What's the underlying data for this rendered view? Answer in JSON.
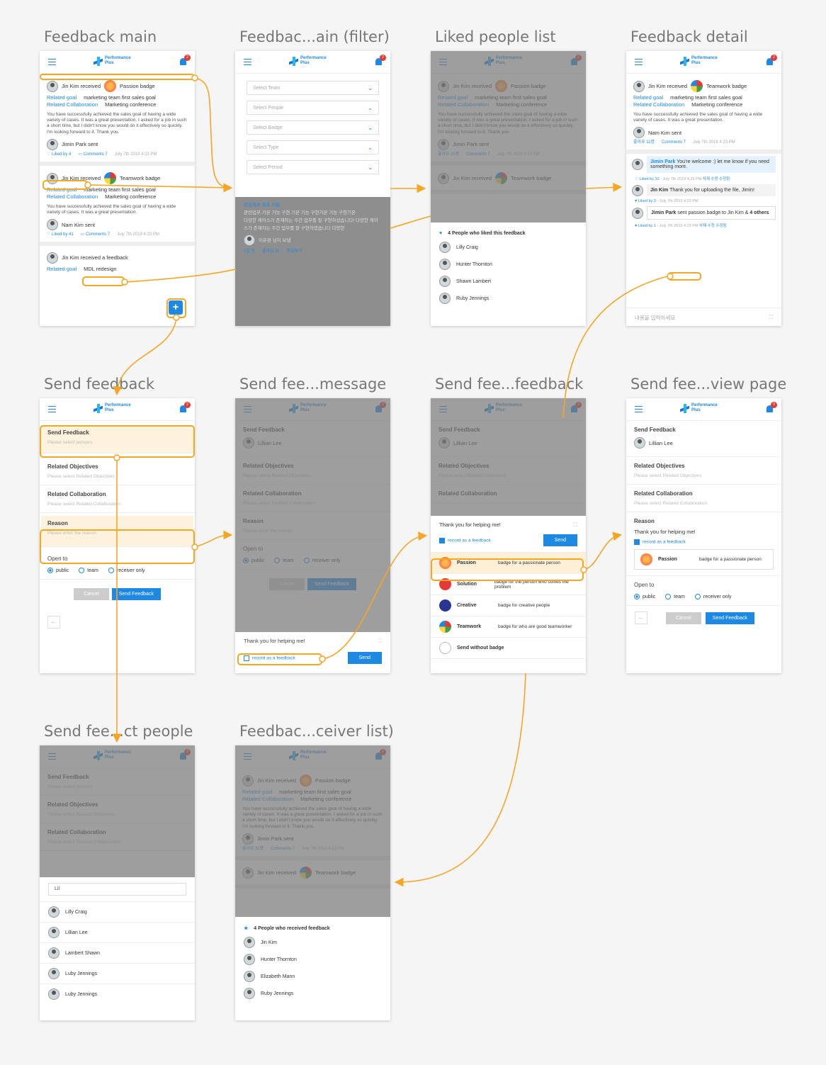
{
  "titles": [
    "Feedback main",
    "Feedbac...ain (filter)",
    "Liked people list",
    "Feedback detail",
    "Send feedback",
    "Send fee...message",
    "Send fee...feedback",
    "Send fee...view page",
    "Send fee...ct people",
    "Feedbac...ceiver list)"
  ],
  "logo": {
    "l1": "Performance",
    "l2": "Plus",
    "badge_count": "2"
  },
  "feed": {
    "jin": "Jin Kim received",
    "passion": "Passion badge",
    "teamwork": "Teamwork badge",
    "rg": "Related goal",
    "rg_val": "marketing team first sales goal",
    "rc": "Related Collaboration",
    "rc_val": "Marketing conference",
    "msg1": "You have successfully achieved the sales goal of having a wide variety of cases. It was a great presentation. I asked for a job in such a short time, but I didn't know you would do it effectively so quickly. I'm looking forward to it. Thank you.",
    "msg2": "You have successfully achieved the sales goal of having a wide variety of cases. It was a great presentation.",
    "jimin": "Jimin Park sent",
    "nam": "Nam Kim sent",
    "liked4": "Liked by 4",
    "liked41": "Liked by 41",
    "comments7": "Comments 7",
    "date": "July 7th 2019 4:23 PM",
    "jin_fb": "Jin Kim received a feedback",
    "rg_mdl": "MDL redesign",
    "ko_like": "좋아요 11명",
    "ko_comments": "Comments 7"
  },
  "filter": {
    "selects": [
      "Select Team",
      "Select People",
      "Select Badge",
      "Select Type",
      "Select Period"
    ],
    "ko1": "관련목표 목표 이름",
    "ko2": "관련업무 기본 기능 구현 기본 기능 구현기본 기능 구현기본",
    "ko3": "다양한 케이스가 존재하는 주간 업무를 잘 구현하셨습니다! 다양한 케이스가 존재하는 주간 업무를 잘 구현하였습니다 다양한",
    "ko4": "이은완 님이 보냄",
    "ko5": "1일 전",
    "ko6": "좋아요 11",
    "ko7": "댓글보기"
  },
  "liked": {
    "head": "4 People who liked this feedback",
    "people": [
      "Lilly Craig",
      "Hunter Thornton",
      "Shawn Lambert",
      "Ruby Jennings"
    ]
  },
  "detail": {
    "c1n": "Jimin Park",
    "c1t": "You're welcome :) let me know if you need something more.",
    "c1m": "Liked by 10",
    "c2n": "Jin Kim",
    "c2t": "Thank you for uploading the file, Jimin!",
    "c2m": "Liked by 3",
    "c3n": "Jimin Park",
    "c3s": "sent",
    "c3t": "passion badge to Jin Kim &",
    "c3o": "4 others",
    "c3m": "Liked by 1",
    "ko_edit": "삭제 수정 수정됨",
    "ko_input": "내용을 입력하세요"
  },
  "send": {
    "h1": "Send Feedback",
    "p1": "Please select persons",
    "h2": "Related Objectives",
    "p2": "Please select Related Objectives",
    "h3": "Related Collaboration",
    "p3": "Please select Related Collaboration",
    "h4": "Reason",
    "p4": "Please enter the reason",
    "h5": "Open to",
    "r1": "public",
    "r2": "team",
    "r3": "receiver only",
    "cancel": "Cancel",
    "send": "Send Feedback",
    "person": "Lillian Lee",
    "thanks": "Thank you for helping me!",
    "record": "record as a feedback",
    "sendbtn": "Send"
  },
  "badges": [
    {
      "n": "Passion",
      "d": "badge for a passionate person"
    },
    {
      "n": "Solution",
      "d": "badge for the person who solves the problem"
    },
    {
      "n": "Creative",
      "d": "badge for creative people"
    },
    {
      "n": "Teamwork",
      "d": "badge for who are good teamworker"
    },
    {
      "n": "Send without badge",
      "d": ""
    }
  ],
  "search": {
    "q": "Lil",
    "people": [
      "Lilly Craig",
      "Lillian Lee",
      "Lambert Shawn",
      "Luby Jennings",
      "Luby Jennings"
    ]
  },
  "receivers": {
    "head": "4 People who received feedback",
    "people": [
      "Jin Kim",
      "Hunter Thornton",
      "Elizabeth Mann",
      "Ruby Jennings"
    ]
  }
}
